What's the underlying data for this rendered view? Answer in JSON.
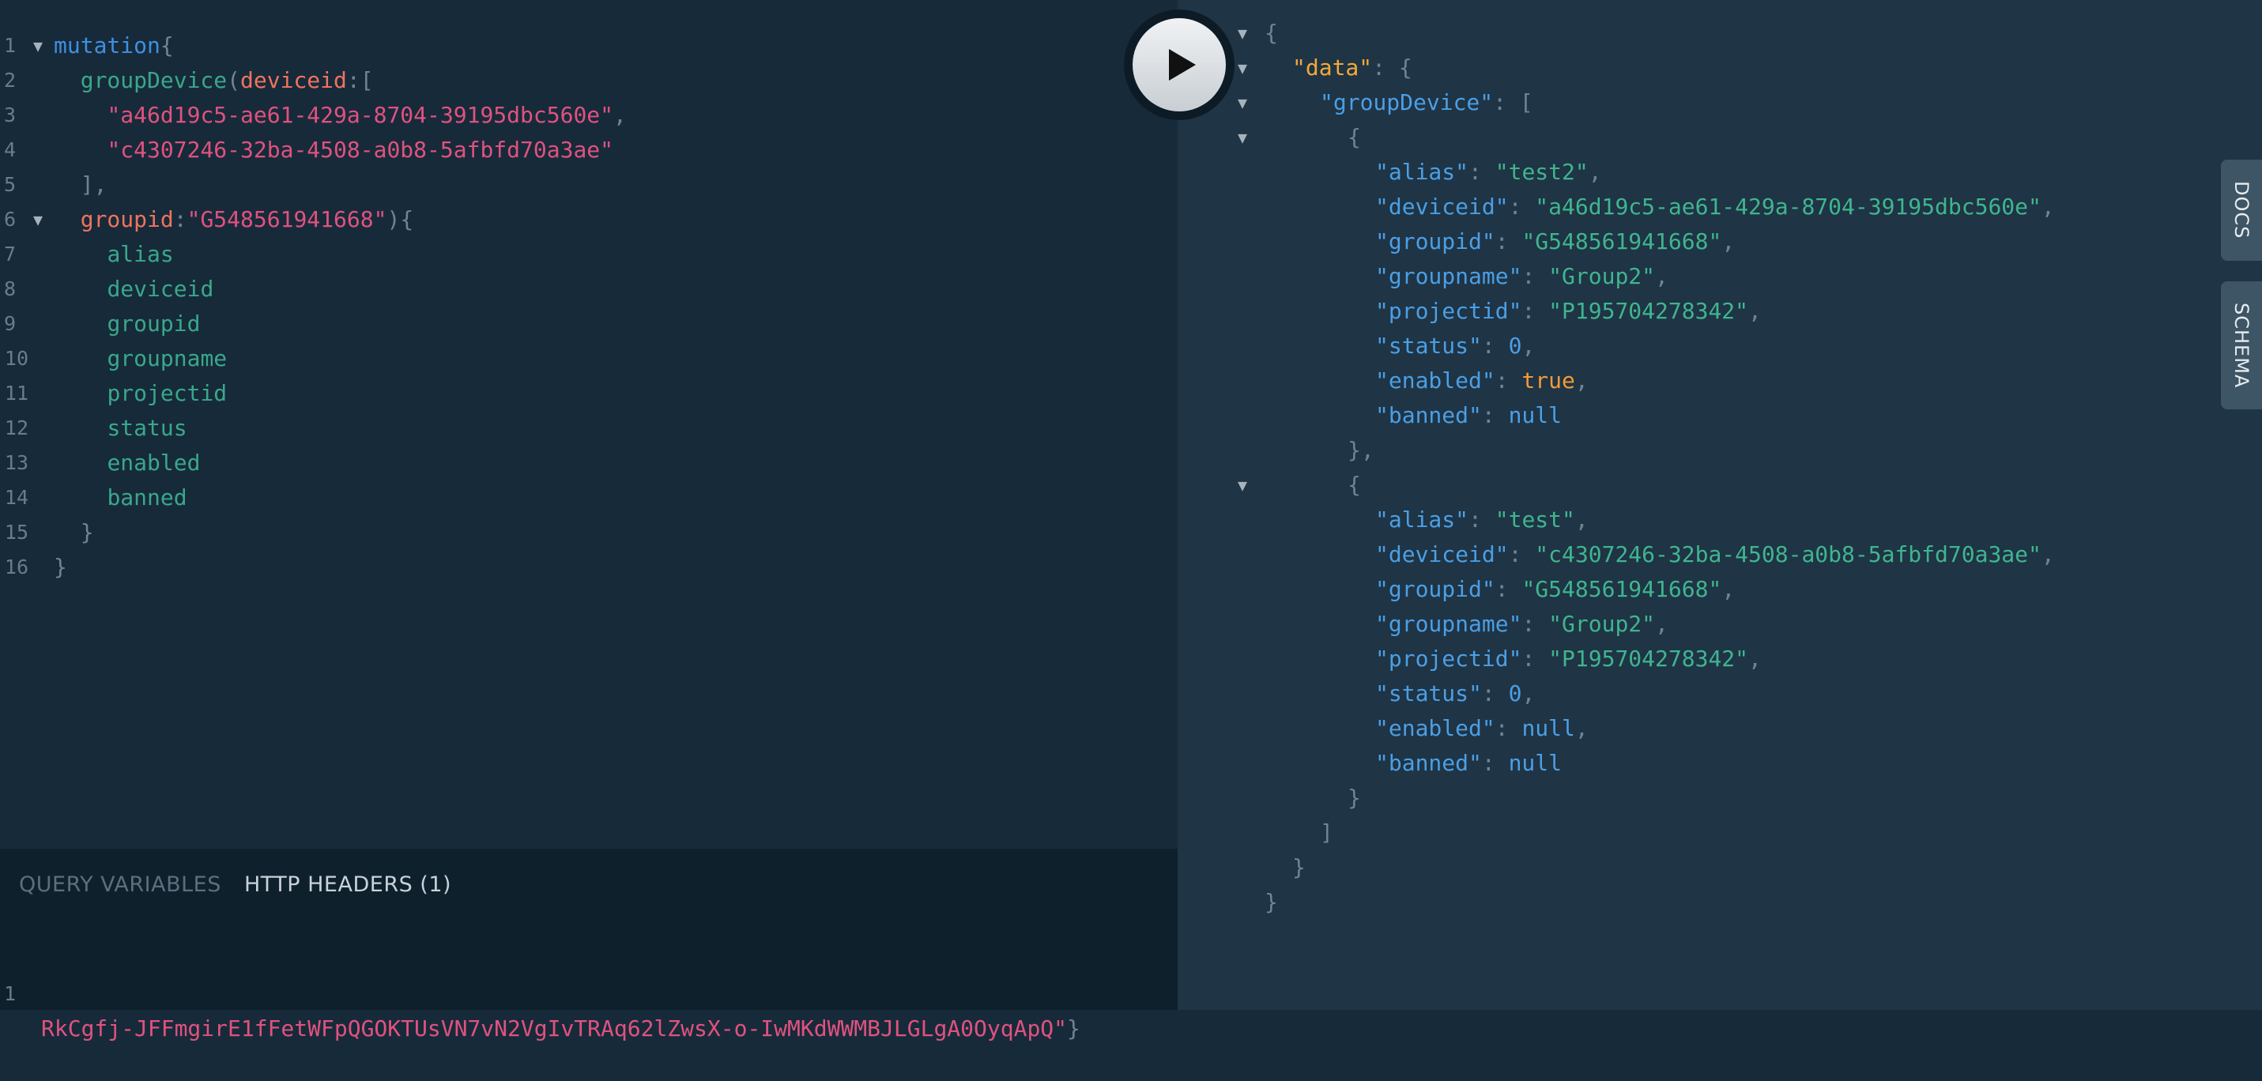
{
  "query_lines": [
    {
      "n": "1",
      "fold": true,
      "tokens": [
        {
          "t": "mutation",
          "c": "kw"
        },
        {
          "t": "{",
          "c": "punc"
        }
      ]
    },
    {
      "n": "2",
      "fold": false,
      "tokens": [
        {
          "t": "  ",
          "c": ""
        },
        {
          "t": "groupDevice",
          "c": "fn"
        },
        {
          "t": "(",
          "c": "punc"
        },
        {
          "t": "deviceid",
          "c": "arg"
        },
        {
          "t": ":[",
          "c": "punc"
        }
      ]
    },
    {
      "n": "3",
      "fold": false,
      "tokens": [
        {
          "t": "    ",
          "c": ""
        },
        {
          "t": "\"a46d19c5-ae61-429a-8704-39195dbc560e\"",
          "c": "str"
        },
        {
          "t": ",",
          "c": "punc"
        }
      ]
    },
    {
      "n": "4",
      "fold": false,
      "tokens": [
        {
          "t": "    ",
          "c": ""
        },
        {
          "t": "\"c4307246-32ba-4508-a0b8-5afbfd70a3ae\"",
          "c": "str"
        }
      ]
    },
    {
      "n": "5",
      "fold": false,
      "tokens": [
        {
          "t": "  ",
          "c": ""
        },
        {
          "t": "],",
          "c": "punc"
        }
      ]
    },
    {
      "n": "6",
      "fold": true,
      "tokens": [
        {
          "t": "  ",
          "c": ""
        },
        {
          "t": "groupid",
          "c": "arg"
        },
        {
          "t": ":",
          "c": "punc"
        },
        {
          "t": "\"G548561941668\"",
          "c": "str"
        },
        {
          "t": "){",
          "c": "punc"
        }
      ]
    },
    {
      "n": "7",
      "fold": false,
      "tokens": [
        {
          "t": "    ",
          "c": ""
        },
        {
          "t": "alias",
          "c": "field"
        }
      ]
    },
    {
      "n": "8",
      "fold": false,
      "tokens": [
        {
          "t": "    ",
          "c": ""
        },
        {
          "t": "deviceid",
          "c": "field"
        }
      ]
    },
    {
      "n": "9",
      "fold": false,
      "tokens": [
        {
          "t": "    ",
          "c": ""
        },
        {
          "t": "groupid",
          "c": "field"
        }
      ]
    },
    {
      "n": "10",
      "fold": false,
      "tokens": [
        {
          "t": "    ",
          "c": ""
        },
        {
          "t": "groupname",
          "c": "field"
        }
      ]
    },
    {
      "n": "11",
      "fold": false,
      "tokens": [
        {
          "t": "    ",
          "c": ""
        },
        {
          "t": "projectid",
          "c": "field"
        }
      ]
    },
    {
      "n": "12",
      "fold": false,
      "tokens": [
        {
          "t": "    ",
          "c": ""
        },
        {
          "t": "status",
          "c": "field"
        }
      ]
    },
    {
      "n": "13",
      "fold": false,
      "tokens": [
        {
          "t": "    ",
          "c": ""
        },
        {
          "t": "enabled",
          "c": "field"
        }
      ]
    },
    {
      "n": "14",
      "fold": false,
      "tokens": [
        {
          "t": "    ",
          "c": ""
        },
        {
          "t": "banned",
          "c": "field"
        }
      ]
    },
    {
      "n": "15",
      "fold": false,
      "tokens": [
        {
          "t": "  ",
          "c": ""
        },
        {
          "t": "}",
          "c": "punc"
        }
      ]
    },
    {
      "n": "16",
      "fold": false,
      "tokens": [
        {
          "t": "}",
          "c": "punc"
        }
      ]
    }
  ],
  "vars_panel": {
    "tab_query_variables": "QUERY VARIABLES",
    "tab_http_headers": "HTTP HEADERS (1)",
    "header_line_number": "1",
    "header_text": "RkCgfj-JFFmgirE1fFetWFpQGOKTUsVN7vN2VgIvTRAq62lZwsX-o-IwMKdWWMBJLGLgA0OyqApQ\"",
    "header_closing": "}"
  },
  "result_lines": [
    {
      "fold": true,
      "indent": 0,
      "tokens": [
        {
          "t": "{",
          "c": "punc"
        }
      ]
    },
    {
      "fold": true,
      "indent": 1,
      "tokens": [
        {
          "t": "\"data\"",
          "c": "jkey-top"
        },
        {
          "t": ": {",
          "c": "punc"
        }
      ]
    },
    {
      "fold": true,
      "indent": 2,
      "tokens": [
        {
          "t": "\"groupDevice\"",
          "c": "jkey"
        },
        {
          "t": ": [",
          "c": "punc"
        }
      ]
    },
    {
      "fold": true,
      "indent": 3,
      "tokens": [
        {
          "t": "{",
          "c": "punc"
        }
      ]
    },
    {
      "fold": false,
      "indent": 4,
      "tokens": [
        {
          "t": "\"alias\"",
          "c": "jkey"
        },
        {
          "t": ": ",
          "c": "punc"
        },
        {
          "t": "\"test2\"",
          "c": "jstr"
        },
        {
          "t": ",",
          "c": "punc"
        }
      ]
    },
    {
      "fold": false,
      "indent": 4,
      "tokens": [
        {
          "t": "\"deviceid\"",
          "c": "jkey"
        },
        {
          "t": ": ",
          "c": "punc"
        },
        {
          "t": "\"a46d19c5-ae61-429a-8704-39195dbc560e\"",
          "c": "jstr"
        },
        {
          "t": ",",
          "c": "punc"
        }
      ]
    },
    {
      "fold": false,
      "indent": 4,
      "tokens": [
        {
          "t": "\"groupid\"",
          "c": "jkey"
        },
        {
          "t": ": ",
          "c": "punc"
        },
        {
          "t": "\"G548561941668\"",
          "c": "jstr"
        },
        {
          "t": ",",
          "c": "punc"
        }
      ]
    },
    {
      "fold": false,
      "indent": 4,
      "tokens": [
        {
          "t": "\"groupname\"",
          "c": "jkey"
        },
        {
          "t": ": ",
          "c": "punc"
        },
        {
          "t": "\"Group2\"",
          "c": "jstr"
        },
        {
          "t": ",",
          "c": "punc"
        }
      ]
    },
    {
      "fold": false,
      "indent": 4,
      "tokens": [
        {
          "t": "\"projectid\"",
          "c": "jkey"
        },
        {
          "t": ": ",
          "c": "punc"
        },
        {
          "t": "\"P195704278342\"",
          "c": "jstr"
        },
        {
          "t": ",",
          "c": "punc"
        }
      ]
    },
    {
      "fold": false,
      "indent": 4,
      "tokens": [
        {
          "t": "\"status\"",
          "c": "jkey"
        },
        {
          "t": ": ",
          "c": "punc"
        },
        {
          "t": "0",
          "c": "jnum"
        },
        {
          "t": ",",
          "c": "punc"
        }
      ]
    },
    {
      "fold": false,
      "indent": 4,
      "tokens": [
        {
          "t": "\"enabled\"",
          "c": "jkey"
        },
        {
          "t": ": ",
          "c": "punc"
        },
        {
          "t": "true",
          "c": "jbool"
        },
        {
          "t": ",",
          "c": "punc"
        }
      ]
    },
    {
      "fold": false,
      "indent": 4,
      "tokens": [
        {
          "t": "\"banned\"",
          "c": "jkey"
        },
        {
          "t": ": ",
          "c": "punc"
        },
        {
          "t": "null",
          "c": "jnull"
        }
      ]
    },
    {
      "fold": false,
      "indent": 3,
      "tokens": [
        {
          "t": "},",
          "c": "punc"
        }
      ]
    },
    {
      "fold": true,
      "indent": 3,
      "tokens": [
        {
          "t": "{",
          "c": "punc"
        }
      ]
    },
    {
      "fold": false,
      "indent": 4,
      "tokens": [
        {
          "t": "\"alias\"",
          "c": "jkey"
        },
        {
          "t": ": ",
          "c": "punc"
        },
        {
          "t": "\"test\"",
          "c": "jstr"
        },
        {
          "t": ",",
          "c": "punc"
        }
      ]
    },
    {
      "fold": false,
      "indent": 4,
      "tokens": [
        {
          "t": "\"deviceid\"",
          "c": "jkey"
        },
        {
          "t": ": ",
          "c": "punc"
        },
        {
          "t": "\"c4307246-32ba-4508-a0b8-5afbfd70a3ae\"",
          "c": "jstr"
        },
        {
          "t": ",",
          "c": "punc"
        }
      ]
    },
    {
      "fold": false,
      "indent": 4,
      "tokens": [
        {
          "t": "\"groupid\"",
          "c": "jkey"
        },
        {
          "t": ": ",
          "c": "punc"
        },
        {
          "t": "\"G548561941668\"",
          "c": "jstr"
        },
        {
          "t": ",",
          "c": "punc"
        }
      ]
    },
    {
      "fold": false,
      "indent": 4,
      "tokens": [
        {
          "t": "\"groupname\"",
          "c": "jkey"
        },
        {
          "t": ": ",
          "c": "punc"
        },
        {
          "t": "\"Group2\"",
          "c": "jstr"
        },
        {
          "t": ",",
          "c": "punc"
        }
      ]
    },
    {
      "fold": false,
      "indent": 4,
      "tokens": [
        {
          "t": "\"projectid\"",
          "c": "jkey"
        },
        {
          "t": ": ",
          "c": "punc"
        },
        {
          "t": "\"P195704278342\"",
          "c": "jstr"
        },
        {
          "t": ",",
          "c": "punc"
        }
      ]
    },
    {
      "fold": false,
      "indent": 4,
      "tokens": [
        {
          "t": "\"status\"",
          "c": "jkey"
        },
        {
          "t": ": ",
          "c": "punc"
        },
        {
          "t": "0",
          "c": "jnum"
        },
        {
          "t": ",",
          "c": "punc"
        }
      ]
    },
    {
      "fold": false,
      "indent": 4,
      "tokens": [
        {
          "t": "\"enabled\"",
          "c": "jkey"
        },
        {
          "t": ": ",
          "c": "punc"
        },
        {
          "t": "null",
          "c": "jnull"
        },
        {
          "t": ",",
          "c": "punc"
        }
      ]
    },
    {
      "fold": false,
      "indent": 4,
      "tokens": [
        {
          "t": "\"banned\"",
          "c": "jkey"
        },
        {
          "t": ": ",
          "c": "punc"
        },
        {
          "t": "null",
          "c": "jnull"
        }
      ]
    },
    {
      "fold": false,
      "indent": 3,
      "tokens": [
        {
          "t": "}",
          "c": "punc"
        }
      ]
    },
    {
      "fold": false,
      "indent": 2,
      "tokens": [
        {
          "t": "]",
          "c": "punc"
        }
      ]
    },
    {
      "fold": false,
      "indent": 1,
      "tokens": [
        {
          "t": "}",
          "c": "punc"
        }
      ]
    },
    {
      "fold": false,
      "indent": 0,
      "tokens": [
        {
          "t": "}",
          "c": "punc"
        }
      ]
    }
  ],
  "side_tabs": {
    "docs": "DOCS",
    "schema": "SCHEMA"
  },
  "icons": {
    "run": "play-icon",
    "fold": "fold-arrow-icon"
  }
}
